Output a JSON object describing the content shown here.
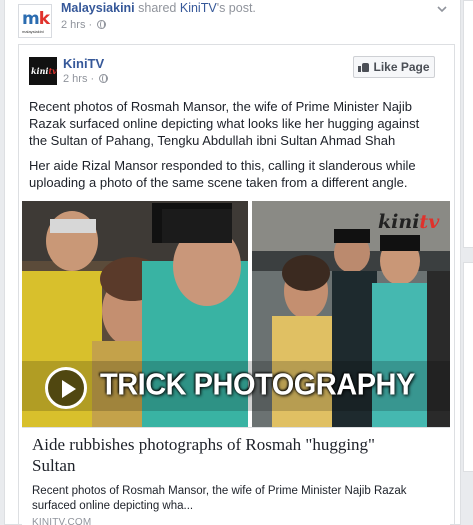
{
  "outer_post": {
    "publisher": "Malaysiakini",
    "action": "shared",
    "shared_page": "KiniTV",
    "shared_suffix": "'s post.",
    "time": "2 hrs",
    "logo_text_m": "m",
    "logo_text_k": "k",
    "logo_sub": "malaysiakini"
  },
  "inner_post": {
    "page_name": "KiniTV",
    "time": "2 hrs",
    "like_button": "Like Page",
    "paragraph_1": "Recent photos of Rosmah Mansor, the wife of Prime Minister Najib Razak surfaced online depicting what looks like her hugging against the Sultan of Pahang, Tengku Abdullah ibni Sultan Ahmad Shah",
    "paragraph_2": "Her aide Rizal Mansor responded to this, calling it slanderous while uploading a photo of the same scene taken from a different angle.",
    "avatar_text_main": "kini",
    "avatar_text_accent": "tv"
  },
  "image": {
    "overlay_text": "TRICK PHOTOGRAPHY",
    "watermark_main": "kini",
    "watermark_accent": "tv"
  },
  "link_preview": {
    "title": "Aide rubbishes photographs of Rosmah \"hugging\" Sultan",
    "description": "Recent photos of Rosmah Mansor, the wife of Prime Minister Najib Razak surfaced online depicting wha...",
    "domain": "KINITV.COM"
  },
  "colors": {
    "link_blue": "#365899",
    "meta_gray": "#90949c",
    "accent_red": "#e0322c"
  }
}
